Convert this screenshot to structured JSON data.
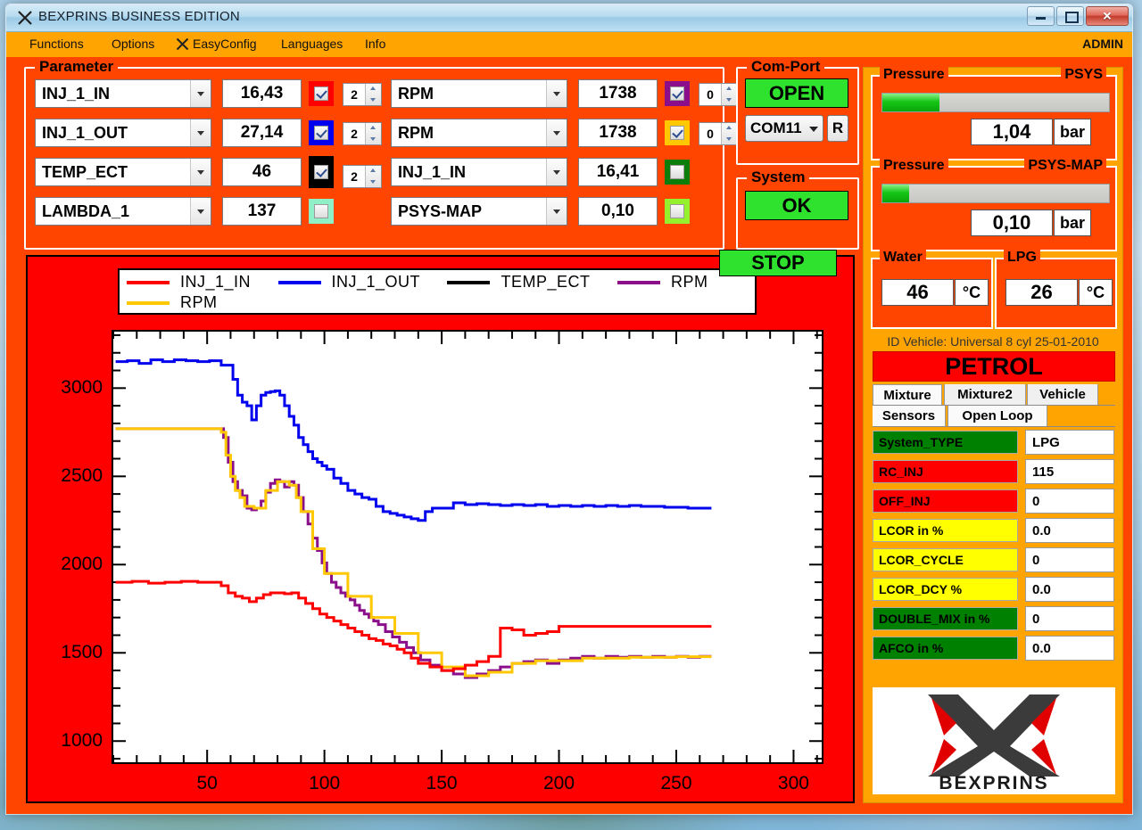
{
  "window": {
    "title": "BEXPRINS  BUSINESS EDITION",
    "minimize_label": "–",
    "maximize_label": "□",
    "close_label": "✕"
  },
  "menu": {
    "items": [
      "Functions",
      "Options",
      "EasyConfig",
      "Languages",
      "Info"
    ],
    "user": "ADMIN"
  },
  "parameter": {
    "legend": "Parameter",
    "left_rows": [
      {
        "name": "INJ_1_IN",
        "value": "16,43",
        "color": "#ff0000",
        "checked": true,
        "spin": "2"
      },
      {
        "name": "INJ_1_OUT",
        "value": "27,14",
        "color": "#0000ee",
        "checked": true,
        "spin": "2"
      },
      {
        "name": "TEMP_ECT",
        "value": "46",
        "color": "#000000",
        "checked": true,
        "spin": "2"
      },
      {
        "name": "LAMBDA_1",
        "value": "137",
        "color": "#8ff0c8",
        "checked": false,
        "spin": ""
      }
    ],
    "right_rows": [
      {
        "name": "RPM",
        "value": "1738",
        "color": "#8b0f8b",
        "checked": true,
        "spin": "0"
      },
      {
        "name": "RPM",
        "value": "1738",
        "color": "#ffc800",
        "checked": true,
        "spin": "0"
      },
      {
        "name": "INJ_1_IN",
        "value": "16,41",
        "color": "#0a7d0a",
        "checked": false,
        "spin": ""
      },
      {
        "name": "PSYS-MAP",
        "value": "0,10",
        "color": "#95f02d",
        "checked": false,
        "spin": ""
      }
    ]
  },
  "comport": {
    "legend": "Com-Port",
    "open_label": "OPEN",
    "port_value": "COM11",
    "refresh_label": "R"
  },
  "system": {
    "legend": "System",
    "status": "OK"
  },
  "chart_controls": {
    "stop_label": "STOP"
  },
  "gauges": {
    "psys": {
      "legend": "Pressure",
      "legend_right": "PSYS",
      "value": "1,04",
      "unit": "bar",
      "fill_percent": 25
    },
    "psys_map": {
      "legend": "Pressure",
      "legend_right": "PSYS-MAP",
      "value": "0,10",
      "unit": "bar",
      "fill_percent": 12
    },
    "water": {
      "legend": "Water",
      "value": "46",
      "unit": "°C"
    },
    "lpg": {
      "legend": "LPG",
      "value": "26",
      "unit": "°C"
    }
  },
  "vehicle": {
    "id_text": "ID Vehicle: Universal 8 cyl 25-01-2010",
    "fuel_mode": "PETROL"
  },
  "tabs": {
    "row1": [
      "Mixture",
      "Mixture2",
      "Vehicle"
    ],
    "row2": [
      "Sensors",
      "Open Loop"
    ],
    "selected": "Mixture"
  },
  "mixture_table": {
    "rows": [
      {
        "key": "System_TYPE",
        "value": "LPG",
        "key_bg": "#008000",
        "key_fg": "#000000"
      },
      {
        "key": "RC_INJ",
        "value": "115",
        "key_bg": "#ff0000",
        "key_fg": "#000000"
      },
      {
        "key": "OFF_INJ",
        "value": "0",
        "key_bg": "#ff0000",
        "key_fg": "#000000"
      },
      {
        "key": "LCOR in %",
        "value": "0.0",
        "key_bg": "#ffff00",
        "key_fg": "#000000"
      },
      {
        "key": "LCOR_CYCLE",
        "value": "0",
        "key_bg": "#ffff00",
        "key_fg": "#000000"
      },
      {
        "key": "LCOR_DCY %",
        "value": "0.0",
        "key_bg": "#ffff00",
        "key_fg": "#000000"
      },
      {
        "key": "DOUBLE_MIX in %",
        "value": "0",
        "key_bg": "#008000",
        "key_fg": "#000000"
      },
      {
        "key": "AFCO in %",
        "value": "0.0",
        "key_bg": "#008000",
        "key_fg": "#000000"
      }
    ]
  },
  "logo": {
    "wordmark": "BEXPRINS"
  },
  "chart_data": {
    "type": "line",
    "title": "",
    "xlabel": "",
    "ylabel": "",
    "xlim": [
      10,
      312
    ],
    "ylim": [
      880,
      3320
    ],
    "xticks": [
      50,
      100,
      150,
      200,
      250,
      300
    ],
    "yticks": [
      1000,
      1500,
      2000,
      2500,
      3000
    ],
    "x_minor_step": 10,
    "y_minor_step": 100,
    "grid": false,
    "legend_position": "top",
    "legend_colors": {
      "INJ_1_IN": "#ff0000",
      "INJ_1_OUT": "#0000ee",
      "TEMP_ECT": "#000000",
      "RPM_purple": "#8b0f8b",
      "RPM_yellow": "#ffc800"
    },
    "series": [
      {
        "name": "INJ_1_OUT",
        "color": "#0000ee",
        "x": [
          11,
          16,
          21,
          26,
          31,
          36,
          41,
          46,
          51,
          56,
          61,
          63,
          65,
          67,
          69,
          71,
          73,
          75,
          77,
          79,
          81,
          83,
          85,
          87,
          89,
          91,
          93,
          95,
          97,
          99,
          101,
          104,
          107,
          110,
          113,
          116,
          119,
          122,
          125,
          128,
          131,
          134,
          137,
          140,
          143,
          146,
          150,
          155,
          160,
          165,
          170,
          175,
          180,
          185,
          190,
          195,
          200,
          205,
          210,
          215,
          220,
          225,
          230,
          235,
          240,
          245,
          250,
          255,
          260,
          265
        ],
        "y": [
          3150,
          3155,
          3140,
          3160,
          3150,
          3160,
          3155,
          3150,
          3155,
          3130,
          3050,
          2960,
          2920,
          2900,
          2820,
          2900,
          2960,
          2975,
          2980,
          2985,
          2960,
          2900,
          2840,
          2790,
          2720,
          2680,
          2640,
          2600,
          2580,
          2560,
          2540,
          2490,
          2460,
          2420,
          2400,
          2380,
          2370,
          2330,
          2300,
          2290,
          2280,
          2270,
          2260,
          2250,
          2300,
          2320,
          2320,
          2350,
          2340,
          2345,
          2340,
          2335,
          2340,
          2335,
          2340,
          2330,
          2335,
          2330,
          2335,
          2330,
          2335,
          2330,
          2335,
          2330,
          2330,
          2325,
          2325,
          2320,
          2320,
          2320
        ]
      },
      {
        "name": "RPM_purple",
        "color": "#8b0f8b",
        "x": [
          11,
          20,
          30,
          40,
          50,
          55,
          57,
          59,
          61,
          63,
          65,
          67,
          69,
          71,
          73,
          75,
          77,
          79,
          81,
          83,
          85,
          87,
          89,
          91,
          93,
          95,
          97,
          99,
          101,
          103,
          105,
          107,
          109,
          111,
          113,
          115,
          117,
          119,
          121,
          123,
          126,
          129,
          132,
          135,
          138,
          141,
          145,
          150,
          155,
          160,
          165,
          170,
          175,
          180,
          185,
          190,
          195,
          200,
          205,
          210,
          215,
          220,
          225,
          230,
          235,
          240,
          245,
          250,
          255,
          260,
          265
        ],
        "y": [
          2770,
          2770,
          2770,
          2770,
          2770,
          2770,
          2720,
          2580,
          2470,
          2420,
          2390,
          2320,
          2310,
          2320,
          2360,
          2410,
          2460,
          2480,
          2470,
          2440,
          2470,
          2450,
          2380,
          2300,
          2230,
          2150,
          2080,
          2010,
          1950,
          1900,
          1870,
          1840,
          1820,
          1800,
          1770,
          1740,
          1720,
          1700,
          1680,
          1660,
          1620,
          1590,
          1560,
          1530,
          1500,
          1460,
          1430,
          1400,
          1380,
          1360,
          1380,
          1400,
          1420,
          1440,
          1450,
          1460,
          1440,
          1460,
          1470,
          1480,
          1470,
          1480,
          1475,
          1480,
          1475,
          1480,
          1475,
          1480,
          1475,
          1480,
          1480
        ]
      },
      {
        "name": "RPM_yellow",
        "color": "#ffc800",
        "x": [
          11,
          30,
          50,
          56,
          58,
          60,
          62,
          64,
          66,
          70,
          75,
          80,
          85,
          88,
          90,
          95,
          100,
          110,
          120,
          130,
          140,
          150,
          160,
          170,
          180,
          190,
          200,
          210,
          220,
          230,
          240,
          250,
          260,
          265
        ],
        "y": [
          2770,
          2770,
          2770,
          2750,
          2620,
          2500,
          2420,
          2380,
          2330,
          2320,
          2420,
          2470,
          2450,
          2380,
          2300,
          2090,
          1950,
          1820,
          1700,
          1610,
          1500,
          1420,
          1370,
          1390,
          1440,
          1455,
          1455,
          1470,
          1470,
          1475,
          1475,
          1478,
          1478,
          1478
        ]
      },
      {
        "name": "INJ_1_IN",
        "color": "#ff0000",
        "x": [
          11,
          18,
          25,
          32,
          39,
          46,
          53,
          56,
          59,
          62,
          65,
          68,
          71,
          74,
          77,
          80,
          83,
          86,
          89,
          92,
          95,
          98,
          101,
          104,
          107,
          110,
          113,
          116,
          119,
          122,
          125,
          128,
          131,
          134,
          137,
          140,
          145,
          150,
          155,
          160,
          165,
          170,
          175,
          180,
          185,
          190,
          195,
          200,
          205,
          210,
          215,
          220,
          225,
          230,
          235,
          240,
          245,
          250,
          255,
          260,
          265
        ],
        "y": [
          1900,
          1905,
          1895,
          1900,
          1905,
          1900,
          1900,
          1880,
          1840,
          1820,
          1810,
          1790,
          1810,
          1830,
          1840,
          1840,
          1835,
          1840,
          1810,
          1780,
          1750,
          1720,
          1700,
          1680,
          1660,
          1640,
          1620,
          1600,
          1580,
          1570,
          1550,
          1540,
          1520,
          1500,
          1470,
          1440,
          1420,
          1400,
          1410,
          1430,
          1450,
          1480,
          1640,
          1630,
          1600,
          1610,
          1620,
          1650,
          1650,
          1650,
          1650,
          1650,
          1650,
          1650,
          1650,
          1650,
          1650,
          1650,
          1650,
          1650,
          1650
        ]
      }
    ]
  }
}
